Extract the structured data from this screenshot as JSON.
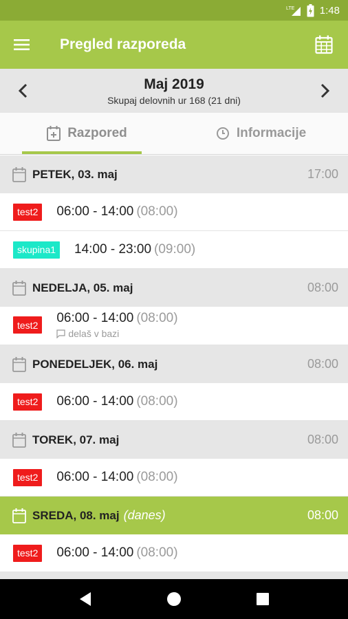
{
  "status_bar": {
    "signal_label": "LTE",
    "time": "1:48",
    "icons": [
      "lte-signal-icon",
      "battery-charging-icon"
    ]
  },
  "app_bar": {
    "title": "Pregled razporeda",
    "menu_icon": "hamburger-menu-icon",
    "calendar_icon": "calendar-grid-icon"
  },
  "month_nav": {
    "title": "Maj 2019",
    "subtitle": "Skupaj delovnih ur 168 (21 dni)"
  },
  "tabs": [
    {
      "label": "Razpored",
      "icon": "calendar-add-icon",
      "active": true
    },
    {
      "label": "Informacije",
      "icon": "clock-icon",
      "active": false
    }
  ],
  "days": [
    {
      "label": "PETEK, 03. maj",
      "hours": "17:00",
      "today": false,
      "shifts": [
        {
          "badge": "test2",
          "badge_color": "#ef1c1c",
          "time": "06:00 - 14:00",
          "duration": "(08:00)"
        },
        {
          "badge": "skupina1",
          "badge_color": "#1ce8c8",
          "time": "14:00 - 23:00",
          "duration": "(09:00)"
        }
      ]
    },
    {
      "label": "NEDELJA, 05. maj",
      "hours": "08:00",
      "today": false,
      "shifts": [
        {
          "badge": "test2",
          "badge_color": "#ef1c1c",
          "time": "06:00 - 14:00",
          "duration": "(08:00)",
          "note": "delaš v bazi"
        }
      ]
    },
    {
      "label": "PONEDELJEK, 06. maj",
      "hours": "08:00",
      "today": false,
      "shifts": [
        {
          "badge": "test2",
          "badge_color": "#ef1c1c",
          "time": "06:00 - 14:00",
          "duration": "(08:00)"
        }
      ]
    },
    {
      "label": "TOREK, 07. maj",
      "hours": "08:00",
      "today": false,
      "shifts": [
        {
          "badge": "test2",
          "badge_color": "#ef1c1c",
          "time": "06:00 - 14:00",
          "duration": "(08:00)"
        }
      ]
    },
    {
      "label": "SREDA, 08. maj",
      "today_label": "(danes)",
      "hours": "08:00",
      "today": true,
      "shifts": [
        {
          "badge": "test2",
          "badge_color": "#ef1c1c",
          "time": "06:00 - 14:00",
          "duration": "(08:00)"
        }
      ]
    }
  ],
  "colors": {
    "accent": "#a6c84a",
    "status_bar": "#8bab35",
    "badge_red": "#ef1c1c",
    "badge_teal": "#1ce8c8"
  },
  "system_nav": {
    "icons": [
      "back-triangle-icon",
      "home-circle-icon",
      "recents-square-icon"
    ]
  }
}
